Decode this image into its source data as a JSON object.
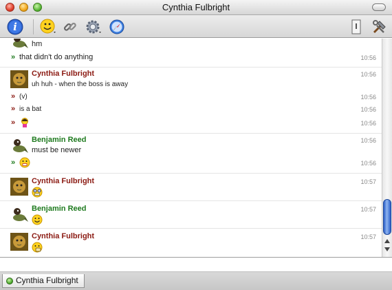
{
  "window": {
    "title": "Cynthia Fulbright"
  },
  "toolbar": {
    "left_icons": [
      "info-icon",
      "smiley-icon",
      "link-icon",
      "gear-icon",
      "compass-icon"
    ],
    "right_icons": [
      "drawer-icon",
      "tools-icon"
    ]
  },
  "messages": [
    {
      "sender": "Benjamin Reed",
      "kind": "partial",
      "text": "hm",
      "time": ""
    },
    {
      "sender": "Benjamin Reed",
      "kind": "cont",
      "text": "that didn't do anything",
      "time": "10:56"
    },
    {
      "sender": "Cynthia Fulbright",
      "kind": "head",
      "text": "uh huh - when the boss is away",
      "time": "10:56"
    },
    {
      "sender": "Cynthia Fulbright",
      "kind": "cont",
      "text": "(v)",
      "time": "10:56"
    },
    {
      "sender": "Cynthia Fulbright",
      "kind": "cont",
      "text": "is a bat",
      "time": "10:56"
    },
    {
      "sender": "Cynthia Fulbright",
      "kind": "cont",
      "emoticon": "girl-emoticon",
      "time": "10:56"
    },
    {
      "sender": "Benjamin Reed",
      "kind": "head",
      "text": "must be newer",
      "time": "10:56"
    },
    {
      "sender": "Benjamin Reed",
      "kind": "cont",
      "emoticon": "shocked-emoticon",
      "time": "10:56"
    },
    {
      "sender": "Cynthia Fulbright",
      "kind": "head",
      "emoticon": "grimace-emoticon",
      "time": "10:57"
    },
    {
      "sender": "Benjamin Reed",
      "kind": "head",
      "emoticon": "smile-emoticon",
      "time": "10:57"
    },
    {
      "sender": "Cynthia Fulbright",
      "kind": "head",
      "emoticon": "thumbs-emoticon",
      "time": "10:57"
    }
  ],
  "tabs": [
    {
      "label": "Cynthia Fulbright",
      "status_color": "#4aa82a"
    }
  ],
  "colors": {
    "cynthia_name": "#8b1a12",
    "benjamin_name": "#1e7a1e",
    "scroll_thumb": "#2a5fc9"
  }
}
